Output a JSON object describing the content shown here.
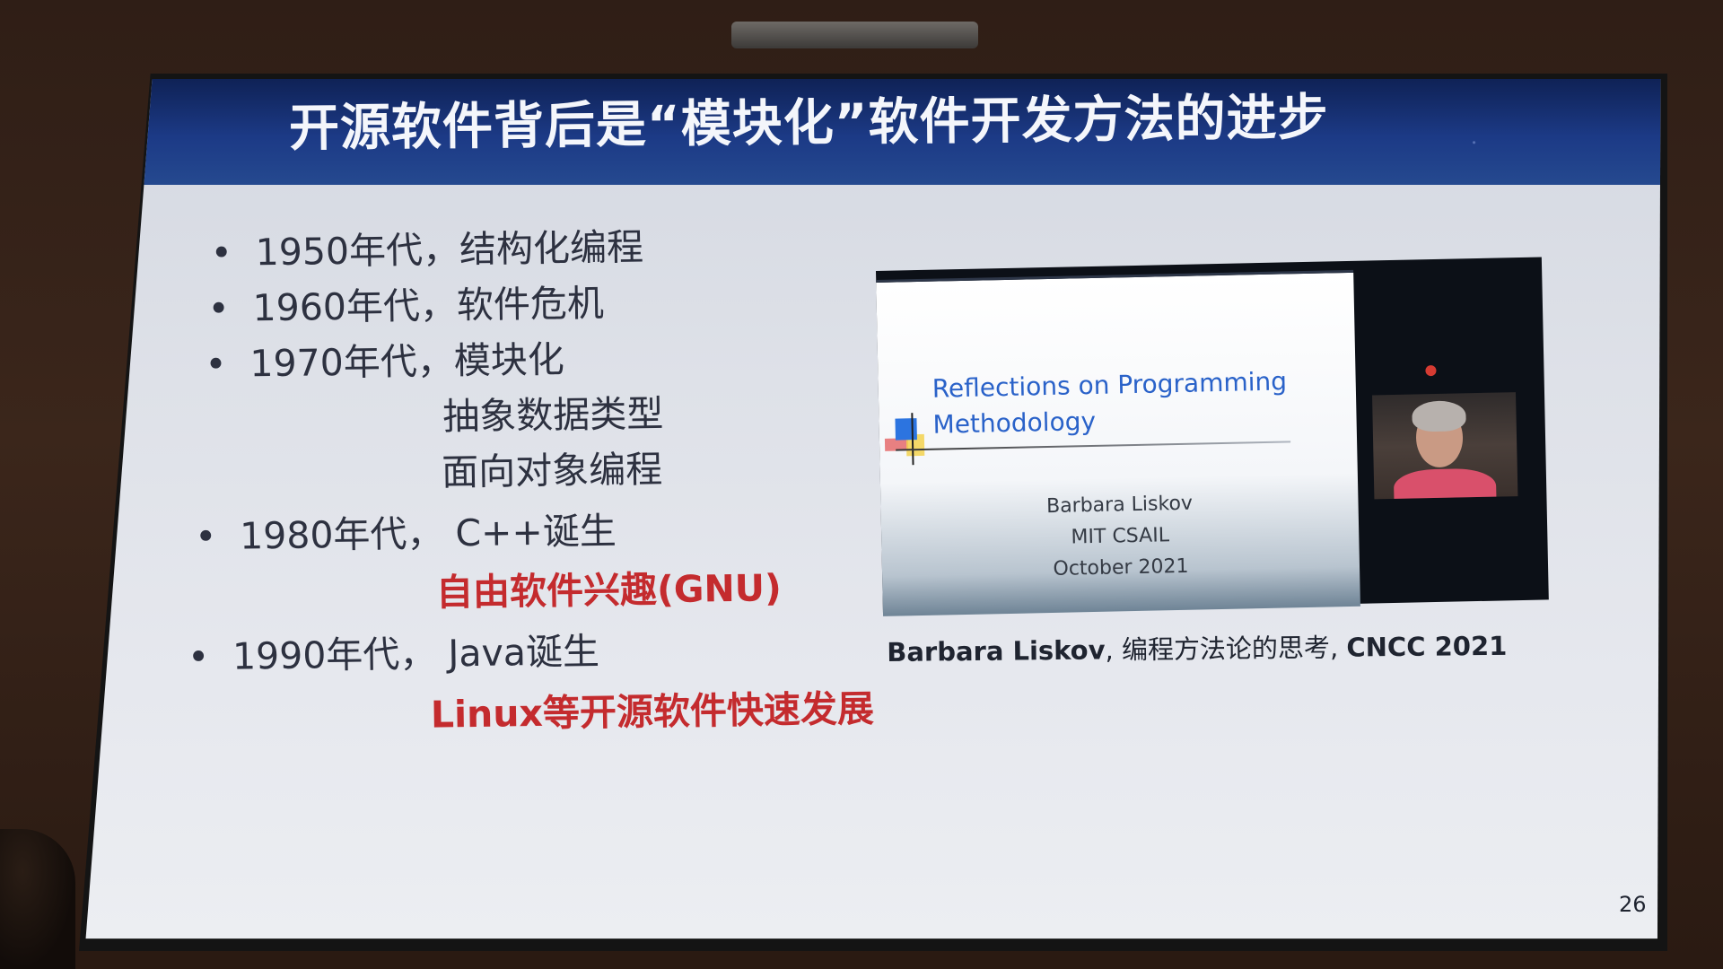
{
  "slide": {
    "title": "开源软件背后是“模块化”软件开发方法的进步",
    "page_number": "26"
  },
  "timeline": [
    {
      "bullet": "•",
      "text": "1950年代，结构化编程"
    },
    {
      "bullet": "•",
      "text": "1960年代，软件危机"
    },
    {
      "bullet": "•",
      "text": "1970年代，模块化"
    },
    {
      "bullet": "",
      "text": "抽象数据类型"
    },
    {
      "bullet": "",
      "text": "面向对象编程"
    },
    {
      "bullet": "•",
      "text": "1980年代，  C++诞生"
    },
    {
      "bullet": "",
      "text": "自由软件兴趣(GNU)",
      "highlight": true
    },
    {
      "bullet": "•",
      "text": "1990年代，  Java诞生"
    },
    {
      "bullet": "",
      "text": "Linux等开源软件快速发展",
      "highlight": true
    }
  ],
  "video": {
    "inner_title_line1": "Reflections on Programming",
    "inner_title_line2": "Methodology",
    "speaker": "Barbara Liskov",
    "affiliation": "MIT CSAIL",
    "date": "October 2021"
  },
  "caption": {
    "speaker": "Barbara Liskov",
    "sep1": ", ",
    "topic": "编程方法论的思考",
    "sep2": ", ",
    "event": "CNCC 2021"
  },
  "colors": {
    "banner": "#1c3a86",
    "highlight_red": "#c42b2e",
    "inner_title_blue": "#2a62c9"
  }
}
